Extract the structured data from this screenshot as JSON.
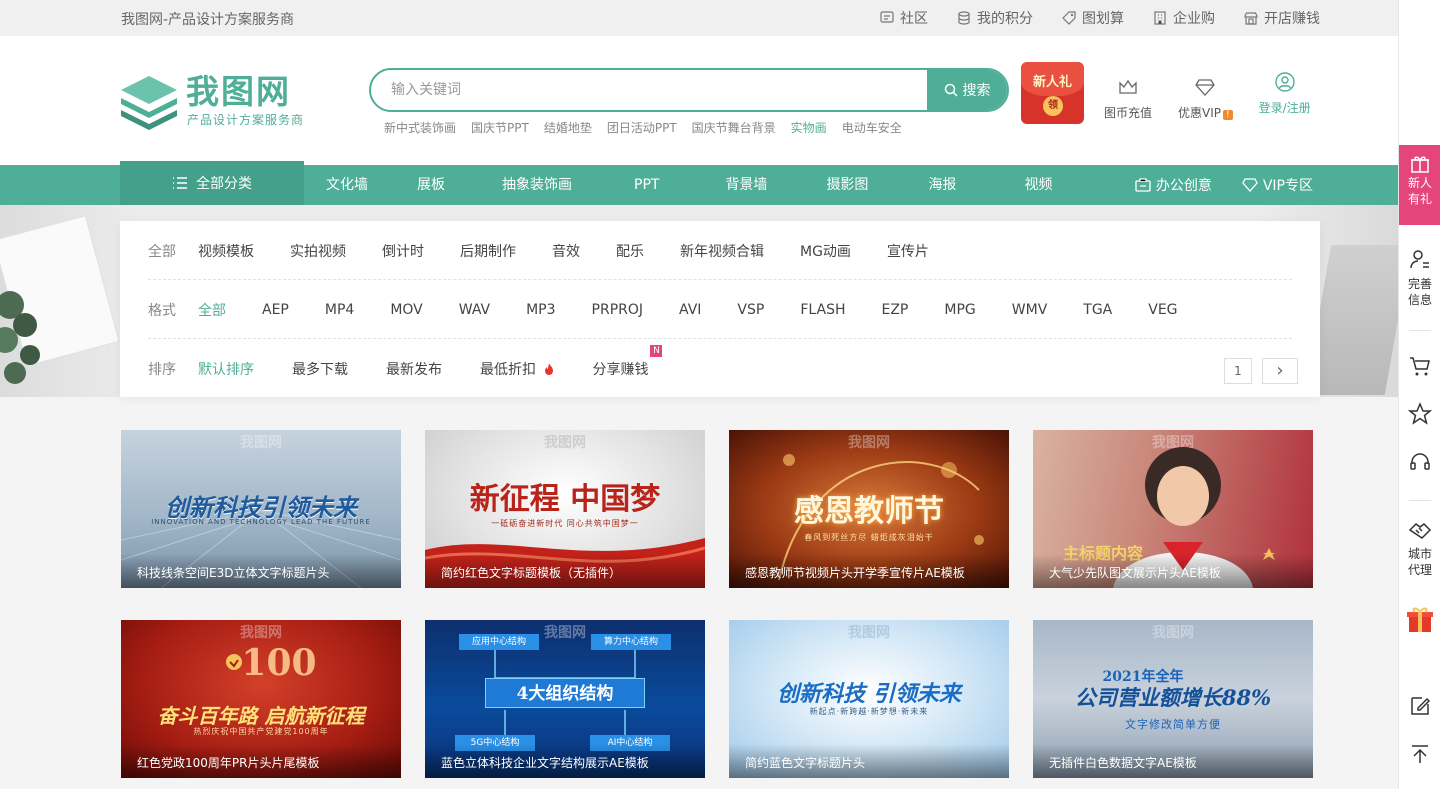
{
  "topbar": {
    "slogan": "我图网-产品设计方案服务商",
    "links": [
      {
        "label": "社区",
        "icon": "chat-icon"
      },
      {
        "label": "我的积分",
        "icon": "coins-icon"
      },
      {
        "label": "图划算",
        "icon": "tag-icon"
      },
      {
        "label": "企业购",
        "icon": "building-icon"
      },
      {
        "label": "开店赚钱",
        "icon": "shop-icon"
      }
    ]
  },
  "logo": {
    "name": "我图网",
    "tagline": "产品设计方案服务商"
  },
  "search": {
    "placeholder": "输入关键词",
    "button_label": "搜索",
    "hot_words": [
      "新中式装饰画",
      "国庆节PPT",
      "结婚地垫",
      "团日活动PPT",
      "国庆节舞台背景",
      "实物画",
      "电动车安全"
    ]
  },
  "promo": {
    "gift_text": "新人礼",
    "gift_coin": "领"
  },
  "header_actions": {
    "recharge": "图币充值",
    "vip": "优惠VIP",
    "vip_badge": "!",
    "login": "登录/注册"
  },
  "nav": {
    "all_categories": "全部分类",
    "links": [
      "文化墙",
      "展板",
      "抽象装饰画",
      "PPT",
      "背景墙",
      "摄影图",
      "海报",
      "视频"
    ],
    "office": "办公创意",
    "vip_zone": "VIP专区"
  },
  "filters": {
    "category": {
      "label": "全部",
      "options": [
        "视频模板",
        "实拍视频",
        "倒计时",
        "后期制作",
        "音效",
        "配乐",
        "新年视频合辑",
        "MG动画",
        "宣传片"
      ]
    },
    "format": {
      "label": "格式",
      "selected": "全部",
      "options": [
        "AEP",
        "MP4",
        "MOV",
        "WAV",
        "MP3",
        "PRPROJ",
        "AVI",
        "VSP",
        "FLASH",
        "EZP",
        "MPG",
        "WMV",
        "TGA",
        "VEG"
      ]
    },
    "sort": {
      "label": "排序",
      "selected": "默认排序",
      "options": [
        "最多下载",
        "最新发布",
        "最低折扣",
        "分享赚钱"
      ],
      "new_badge": "N"
    },
    "pager": {
      "page": "1",
      "next": "›"
    }
  },
  "watermark": "我图网",
  "cards": [
    {
      "caption": "科技线条空间E3D立体文字标题片头",
      "headline": "创新科技引领未来",
      "sub": "INNOVATION AND TECHNOLOGY LEAD THE FUTURE"
    },
    {
      "caption": "简约红色文字标题模板（无插件）",
      "headline": "新征程 中国梦",
      "sub": "一砥砺奋进新时代 同心共筑中国梦一"
    },
    {
      "caption": "感恩教师节视频片头开学季宣传片AE模板",
      "headline": "感恩教师节",
      "sub": "春风到死丝方尽 蜡炬成灰泪始干"
    },
    {
      "caption": "大气少先队图文展示片头AE模板",
      "headline": "主标题内容",
      "sub": ""
    },
    {
      "caption": "红色党政100周年PR片头片尾模板",
      "headline": "奋斗百年路 启航新征程",
      "sub": "热烈庆祝中国共产党建党100周年",
      "number": "100"
    },
    {
      "caption": "蓝色立体科技企业文字结构展示AE模板",
      "headline": "4大组织结构",
      "sub": "",
      "nodes": [
        "应用中心结构",
        "算力中心结构",
        "5G中心结构",
        "AI中心结构"
      ]
    },
    {
      "caption": "简约蓝色文字标题片头",
      "headline": "创新科技 引领未来",
      "sub": "新起点·新跨越·新梦想·新未来"
    },
    {
      "caption": "无插件白色数据文字AE模板",
      "headline": "公司营业额增长88%",
      "sub": "文字修改简单方便",
      "year": "2021年全年"
    }
  ],
  "rail": {
    "new_gift": "新人有礼",
    "complete_info": "完善信息",
    "city_agent": "城市代理"
  },
  "colors": {
    "brand": "#4fae98",
    "hot": "#e4457a"
  }
}
